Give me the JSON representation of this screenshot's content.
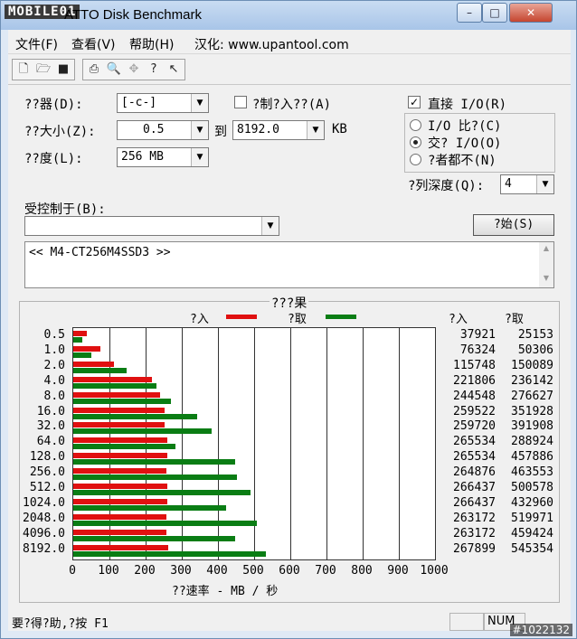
{
  "window": {
    "logo": "MOBILE01",
    "title": "ATTO Disk Benchmark"
  },
  "menu": [
    "文件(F)",
    "查看(V)",
    "帮助(H)",
    "汉化: www.upantool.com"
  ],
  "form": {
    "drive_label": "??器(D):",
    "drive_value": "[-c-]",
    "force_write_label": "?制?入??(A)",
    "direct_io_label": "直接 I/O(R)",
    "transfer_label": "??大小(Z):",
    "transfer_from": "0.5",
    "to_label": "到",
    "transfer_to": "8192.0",
    "unit_label": "KB",
    "length_label": "??度(L):",
    "length_value": "256 MB",
    "radio_io_compare": "I/O 比?(C)",
    "radio_overlapped": "交? I/O(O)",
    "radio_neither": "?者都不(N)",
    "queue_label": "?列深度(Q):",
    "queue_value": "4",
    "controlled_label": "受控制于(B):",
    "start_button": "?始(S)",
    "info_text": "<<  M4-CT256M4SSD3   >>"
  },
  "results": {
    "title": "???果",
    "legend_write": "?入",
    "legend_read": "?取",
    "col_write": "?入",
    "col_read": "?取",
    "xaxis_label": "??速率 - MB / 秒"
  },
  "status": {
    "text": "要?得?助,?按 F1",
    "num": "NUM",
    "watermark": "#1022132"
  },
  "chart_data": {
    "type": "bar",
    "categories": [
      "0.5",
      "1.0",
      "2.0",
      "4.0",
      "8.0",
      "16.0",
      "32.0",
      "64.0",
      "128.0",
      "256.0",
      "512.0",
      "1024.0",
      "2048.0",
      "4096.0",
      "8192.0"
    ],
    "series": [
      {
        "name": "?入",
        "values": [
          37921,
          76324,
          115748,
          221806,
          244548,
          259522,
          259720,
          265534,
          265534,
          264876,
          266437,
          266437,
          263172,
          263172,
          267899
        ]
      },
      {
        "name": "?取",
        "values": [
          25153,
          50306,
          150089,
          236142,
          276627,
          351928,
          391908,
          288924,
          457886,
          463553,
          500578,
          432960,
          519971,
          459424,
          545354
        ]
      }
    ],
    "xticks": [
      "0",
      "100",
      "200",
      "300",
      "400",
      "500",
      "600",
      "700",
      "800",
      "900",
      "1000"
    ],
    "xlim": [
      0,
      1000
    ],
    "xlabel": "??速率 - MB / 秒",
    "orientation": "horizontal",
    "colors": {
      "write": "#e01010",
      "read": "#0a7d14"
    }
  }
}
